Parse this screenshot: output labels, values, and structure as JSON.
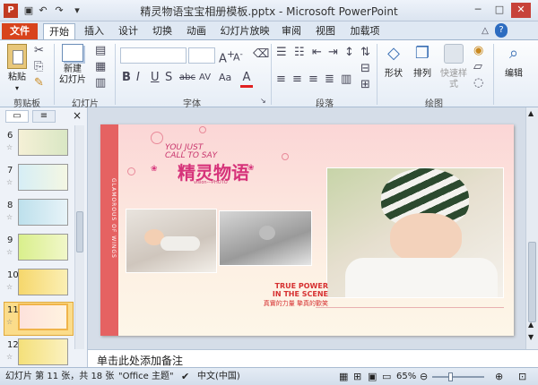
{
  "window": {
    "title": "精灵物语宝宝相册模板.pptx - Microsoft PowerPoint",
    "quick_access": [
      "save-icon",
      "undo-icon",
      "redo-icon",
      "customize-icon"
    ],
    "controls": [
      "minimize-icon",
      "maximize-icon",
      "close-icon"
    ]
  },
  "tabs": [
    "文件",
    "开始",
    "插入",
    "设计",
    "切换",
    "动画",
    "幻灯片放映",
    "审阅",
    "视图",
    "加载项"
  ],
  "active_tab": "开始",
  "ribbon": {
    "groups": [
      "剪贴板",
      "幻灯片",
      "字体",
      "段落",
      "绘图"
    ],
    "paste_label": "粘贴",
    "new_slide_label": "新建\n幻灯片",
    "shape_label": "形状",
    "arrange_label": "排列",
    "quick_style_label": "快速样式",
    "edit_label": "编辑",
    "font_buttons": [
      "B",
      "I",
      "U",
      "S",
      "abc",
      "AV",
      "Aa",
      "A"
    ]
  },
  "slide_panel": {
    "tabs": [
      "slides-tab",
      "outline-tab"
    ],
    "close": "×",
    "thumbnails": [
      {
        "num": "6"
      },
      {
        "num": "7"
      },
      {
        "num": "8"
      },
      {
        "num": "9"
      },
      {
        "num": "10"
      },
      {
        "num": "11",
        "selected": true
      },
      {
        "num": "12"
      }
    ],
    "star": "☆"
  },
  "slide": {
    "headline_en": "YOU JUST\nCALL TO SAY",
    "headline_cn": "精灵物语",
    "subline": "vision---PHOTO",
    "side_text": "GLAMOROUS OF WINGS",
    "true_power": "TRUE POWER",
    "in_scene": "IN THE SCENE",
    "cn_caption": "真實的力量 摯真的歡笑",
    "accent_color": "#e05a5a",
    "title_color": "#d6337a"
  },
  "notes_placeholder": "单击此处添加备注",
  "status": {
    "slide_info": "幻灯片 第 11 张，共 18 张",
    "theme": "\"Office 主题\"",
    "language": "中文(中国)",
    "zoom": "65%"
  }
}
